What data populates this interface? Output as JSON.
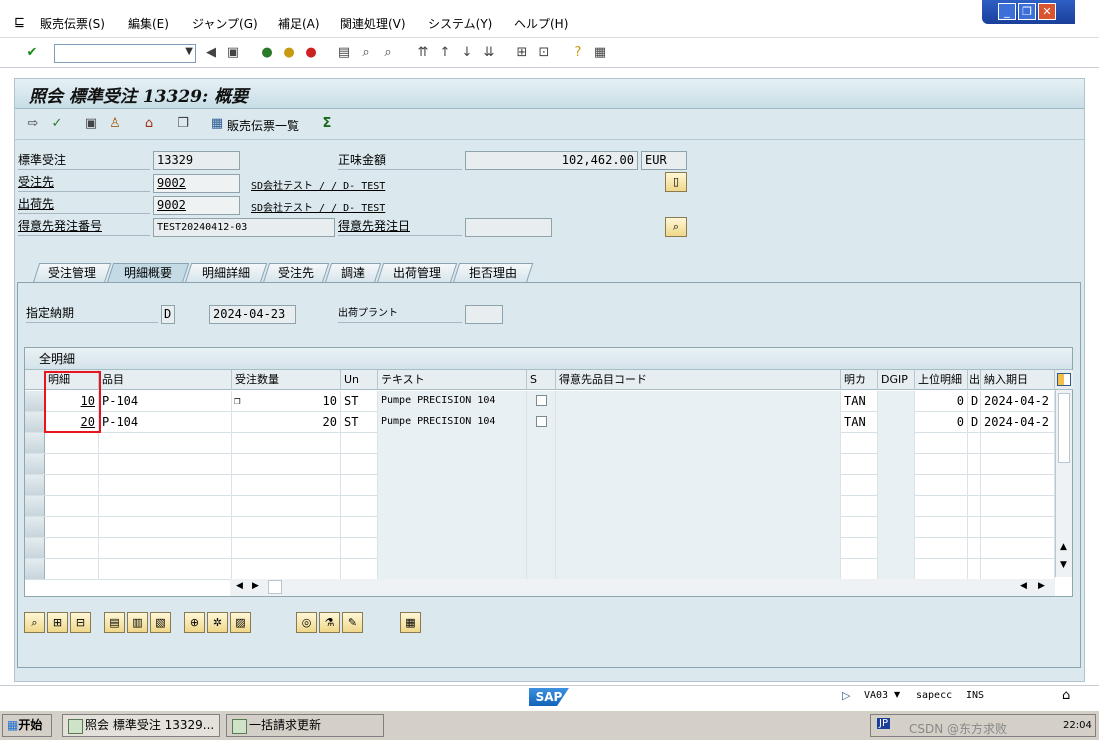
{
  "menu": {
    "items": [
      "販売伝票(S)",
      "編集(E)",
      "ジャンプ(G)",
      "補足(A)",
      "関連処理(V)",
      "システム(Y)",
      "ヘルプ(H)"
    ]
  },
  "window": {
    "min": "_",
    "restore": "❐",
    "close": "✕"
  },
  "title": "照会 標準受注 13329: 概要",
  "apptoolbar": {
    "sales_doc_list": "販売伝票一覧"
  },
  "header": {
    "order_type_label": "標準受注",
    "order_type_value": "13329",
    "net_label": "正味金額",
    "net_value": "102,462.00",
    "currency": "EUR",
    "soldto_label": "受注先",
    "soldto_value": "9002",
    "soldto_text": "SD会社テスト / / D- TEST",
    "shipto_label": "出荷先",
    "shipto_value": "9002",
    "shipto_text": "SD会社テスト / / D- TEST",
    "po_label": "得意先発注番号",
    "po_value": "TEST20240412-03",
    "po_date_label": "得意先発注日"
  },
  "tabs": [
    "受注管理",
    "明細概要",
    "明細詳細",
    "受注先",
    "調達",
    "出荷管理",
    "拒否理由"
  ],
  "overview": {
    "req_date_label": "指定納期",
    "req_date_type": "D",
    "req_date": "2024-04-23",
    "plant_label": "出荷プラント"
  },
  "table": {
    "title": "全明細",
    "headers": [
      "明細",
      "品目",
      "受注数量",
      "Un",
      "テキスト",
      "S",
      "得意先品目コード",
      "明カ",
      "DGIP",
      "上位明細",
      "出",
      "納入期日"
    ],
    "rows": [
      [
        "10",
        "P-104",
        "10",
        "ST",
        "Pumpe PRECISION 104",
        "",
        "",
        "TAN",
        "",
        "0",
        "D",
        "2024-04-2"
      ],
      [
        "20",
        "P-104",
        "20",
        "ST",
        "Pumpe PRECISION 104",
        "",
        "",
        "TAN",
        "",
        "0",
        "D",
        "2024-04-2"
      ]
    ]
  },
  "status": {
    "tcode": "VA03",
    "server": "sapecc",
    "mode": "INS"
  },
  "taskbar": {
    "start": "开始",
    "task1": "照会 標準受注 13329...",
    "task2": "一括請求更新",
    "lang": "JP",
    "clock": "22:04"
  },
  "watermark": "CSDN @东方求败"
}
